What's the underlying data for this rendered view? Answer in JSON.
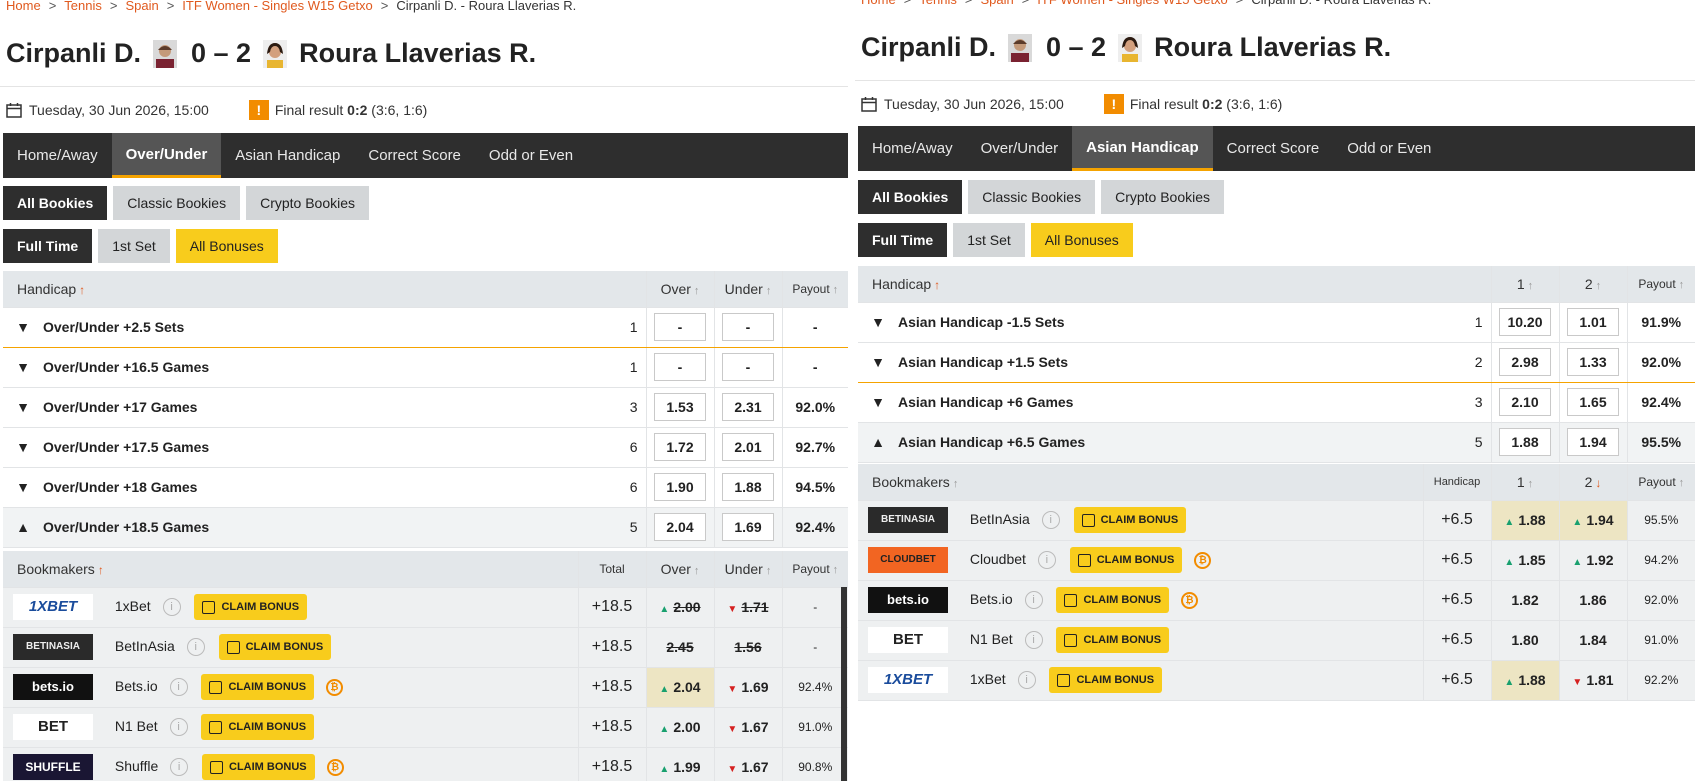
{
  "colors": {
    "accent": "#e05a1f",
    "tab_active_border": "#f5a300",
    "dark": "#2e2e2e",
    "yellow": "#f8cc1c",
    "odds_up": "#18a06e",
    "odds_down": "#d52020"
  },
  "breadcrumb": {
    "home": "Home",
    "sport": "Tennis",
    "country": "Spain",
    "tournament": "ITF Women - Singles W15 Getxo",
    "current": "Cirpanli D. - Roura Llaverias R."
  },
  "match": {
    "home": "Cirpanli D.",
    "away": "Roura Llaverias R.",
    "score": "0 – 2",
    "date": "Tuesday, 30 Jun 2026, 15:00",
    "result_label": "Final result",
    "result_score": "0:2",
    "result_sets": "(3:6, 1:6)",
    "alert_glyph": "!"
  },
  "tabs": [
    "Home/Away",
    "Over/Under",
    "Asian Handicap",
    "Correct Score",
    "Odd or Even"
  ],
  "bookie_filters": [
    "All Bookies",
    "Classic Bookies",
    "Crypto Bookies"
  ],
  "period_filters": [
    "Full Time",
    "1st Set",
    "All Bonuses"
  ],
  "claim_label": "CLAIM BONUS",
  "info_glyph": "i",
  "btc_glyph": "₿",
  "left": {
    "head": {
      "handicap": "Handicap",
      "c1": "Over",
      "c2": "Under",
      "payout": "Payout"
    },
    "sub_head": {
      "bookmakers": "Bookmakers",
      "mid": "Total",
      "c1": "Over",
      "c2": "Under",
      "payout": "Payout"
    },
    "rows": [
      {
        "name": "Over/Under +2.5 Sets",
        "count": "1",
        "o1": "-",
        "o2": "-",
        "payout": "-"
      },
      {
        "name": "Over/Under +16.5 Games",
        "count": "1",
        "o1": "-",
        "o2": "-",
        "payout": "-"
      },
      {
        "name": "Over/Under +17 Games",
        "count": "3",
        "o1": "1.53",
        "o2": "2.31",
        "payout": "92.0%"
      },
      {
        "name": "Over/Under +17.5 Games",
        "count": "6",
        "o1": "1.72",
        "o2": "2.01",
        "payout": "92.7%"
      },
      {
        "name": "Over/Under +18 Games",
        "count": "6",
        "o1": "1.90",
        "o2": "1.88",
        "payout": "94.5%"
      },
      {
        "name": "Over/Under +18.5 Games",
        "count": "5",
        "o1": "2.04",
        "o2": "1.69",
        "payout": "92.4%"
      }
    ],
    "bookmakers": [
      {
        "logo": "1XBET",
        "name": "1xBet",
        "line": "+18.5",
        "o1": "2.00",
        "o2": "1.71",
        "payout": "-"
      },
      {
        "logo": "BETINASIA",
        "name": "BetInAsia",
        "line": "+18.5",
        "o1": "2.45",
        "o2": "1.56",
        "payout": "-"
      },
      {
        "logo": "bets.io",
        "name": "Bets.io",
        "line": "+18.5",
        "o1": "2.04",
        "o2": "1.69",
        "payout": "92.4%"
      },
      {
        "logo": "BET",
        "name": "N1 Bet",
        "line": "+18.5",
        "o1": "2.00",
        "o2": "1.67",
        "payout": "91.0%"
      },
      {
        "logo": "SHUFFLE",
        "name": "Shuffle",
        "line": "+18.5",
        "o1": "1.99",
        "o2": "1.67",
        "payout": "90.8%"
      }
    ]
  },
  "right": {
    "head": {
      "handicap": "Handicap",
      "c1": "1",
      "c2": "2",
      "payout": "Payout"
    },
    "sub_head": {
      "bookmakers": "Bookmakers",
      "mid": "Handicap",
      "c1": "1",
      "c2": "2",
      "payout": "Payout"
    },
    "rows": [
      {
        "name": "Asian Handicap -1.5 Sets",
        "count": "1",
        "o1": "10.20",
        "o2": "1.01",
        "payout": "91.9%"
      },
      {
        "name": "Asian Handicap +1.5 Sets",
        "count": "2",
        "o1": "2.98",
        "o2": "1.33",
        "payout": "92.0%"
      },
      {
        "name": "Asian Handicap +6 Games",
        "count": "3",
        "o1": "2.10",
        "o2": "1.65",
        "payout": "92.4%"
      },
      {
        "name": "Asian Handicap +6.5 Games",
        "count": "5",
        "o1": "1.88",
        "o2": "1.94",
        "payout": "95.5%"
      }
    ],
    "bookmakers": [
      {
        "logo": "BETINASIA",
        "name": "BetInAsia",
        "line": "+6.5",
        "o1": "1.88",
        "o2": "1.94",
        "payout": "95.5%"
      },
      {
        "logo": "CLOUDBET",
        "name": "Cloudbet",
        "line": "+6.5",
        "o1": "1.85",
        "o2": "1.92",
        "payout": "94.2%"
      },
      {
        "logo": "bets.io",
        "name": "Bets.io",
        "line": "+6.5",
        "o1": "1.82",
        "o2": "1.86",
        "payout": "92.0%"
      },
      {
        "logo": "BET",
        "name": "N1 Bet",
        "line": "+6.5",
        "o1": "1.80",
        "o2": "1.84",
        "payout": "91.0%"
      },
      {
        "logo": "1XBET",
        "name": "1xBet",
        "line": "+6.5",
        "o1": "1.88",
        "o2": "1.81",
        "payout": "92.2%"
      }
    ]
  }
}
